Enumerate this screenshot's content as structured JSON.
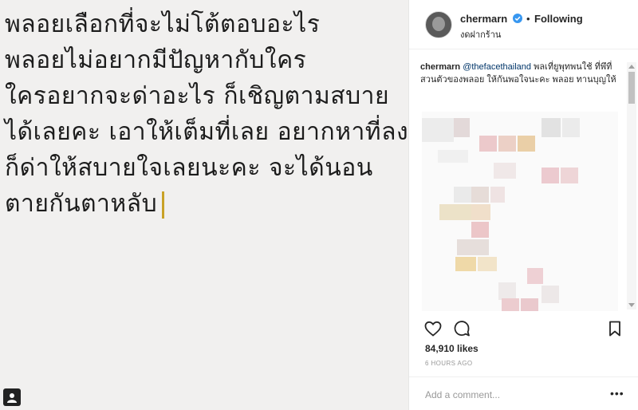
{
  "post": {
    "lines": [
      "พลอยเลือกที่จะไม่โต้ตอบอะไร",
      "พลอยไม่อยากมีปัญหากับใคร",
      "ใครอยากจะด่าอะไร ก็เชิญตามสบาย",
      "ได้เลยคะ เอาให้เต็มที่เลย อยากหาที่ลง",
      "ก็ด่าให้สบายใจเลยนะคะ จะได้นอน",
      "ตายกันตาหลับ"
    ],
    "cursor_color": "#c9a227"
  },
  "header": {
    "username": "chermarn",
    "follow_status": "Following",
    "location": "งดฝากร้าน",
    "separator": "•"
  },
  "caption": {
    "username": "chermarn",
    "mention": "@thefacethailand",
    "text": "พลเที่ยูพุทพนใช้ ที่พึที่สวนตัวของพลอย ให้กันพอใจนะคะ พลอย ทานบุญให้"
  },
  "stats": {
    "likes": "84,910 likes",
    "time_ago": "6 HOURS AGO"
  },
  "comment": {
    "placeholder": "Add a comment...",
    "more_label": "•••"
  },
  "icons": {
    "like": "heart-icon",
    "comment": "comment-icon",
    "save": "bookmark-icon",
    "verified": "verified-badge-icon",
    "corner": "user-tag-icon"
  },
  "colors": {
    "verified": "#3897f0",
    "mention": "#003569"
  }
}
